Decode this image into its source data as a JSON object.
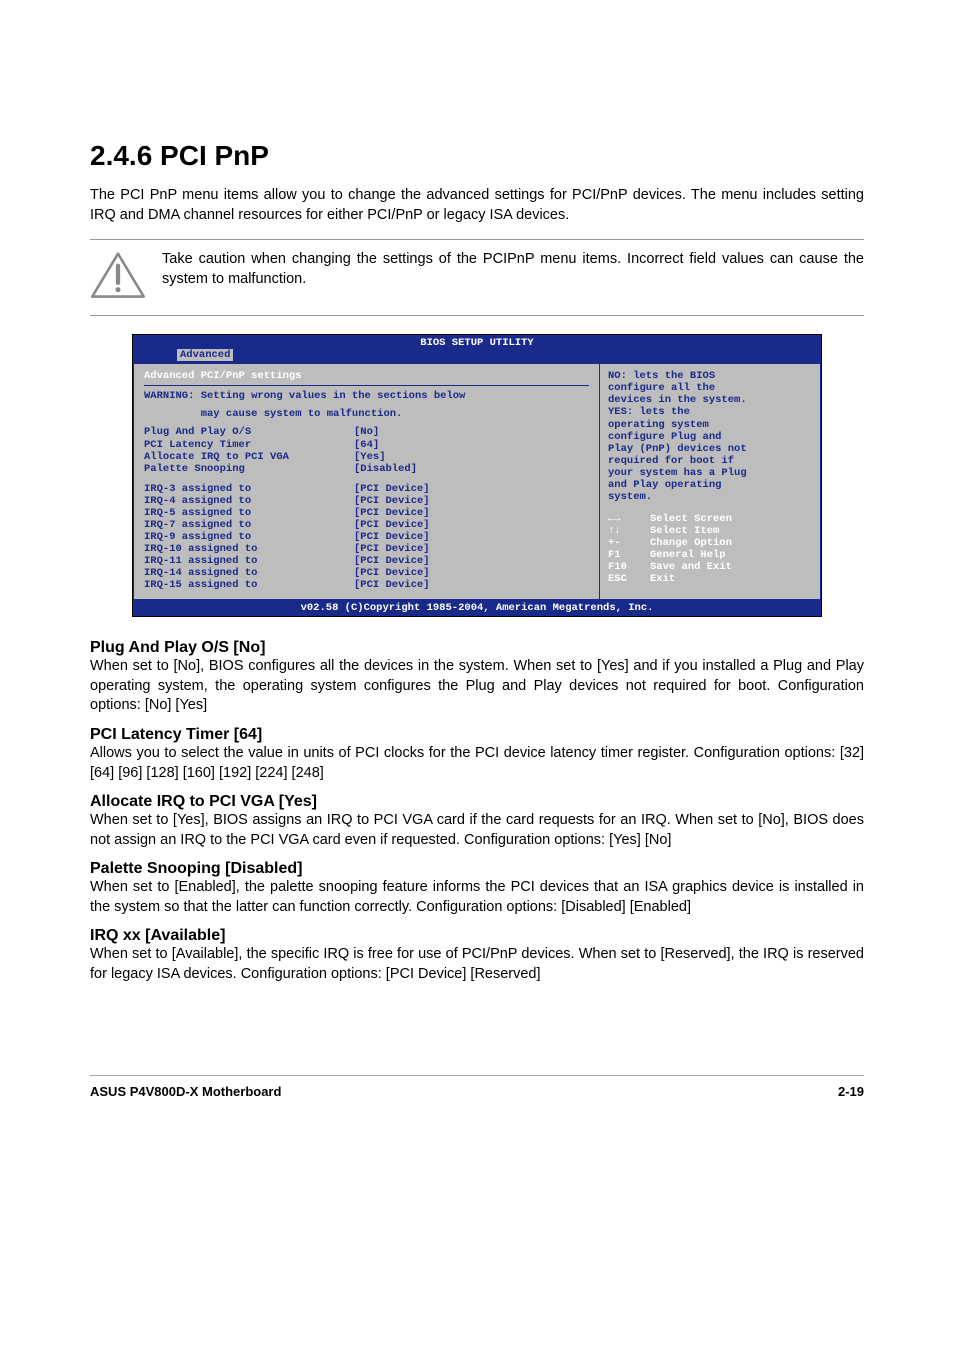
{
  "heading": "2.4.6   PCI PnP",
  "intro": "The PCI PnP menu items allow you to change the advanced settings for PCI/PnP devices. The menu includes setting IRQ and DMA channel resources for either PCI/PnP or legacy ISA devices.",
  "caution": "Take caution when changing the settings of the PCIPnP menu items. Incorrect field values can cause the system to malfunction.",
  "bios": {
    "title": "BIOS SETUP UTILITY",
    "tab_active": "Advanced",
    "subtitle": "Advanced PCI/PnP settings",
    "warning_l1": "WARNING: Setting wrong values in the sections below",
    "warning_l2": "         may cause system to malfunction.",
    "settings": [
      {
        "label": "Plug And Play O/S",
        "value": "[No]"
      },
      {
        "label": "PCI Latency Timer",
        "value": "[64]"
      },
      {
        "label": "Allocate IRQ to PCI VGA",
        "value": "[Yes]"
      },
      {
        "label": "Palette Snooping",
        "value": "[Disabled]"
      }
    ],
    "irqs": [
      {
        "label": "IRQ-3 assigned to",
        "value": "[PCI Device]"
      },
      {
        "label": "IRQ-4 assigned to",
        "value": "[PCI Device]"
      },
      {
        "label": "IRQ-5 assigned to",
        "value": "[PCI Device]"
      },
      {
        "label": "IRQ-7 assigned to",
        "value": "[PCI Device]"
      },
      {
        "label": "IRQ-9 assigned to",
        "value": "[PCI Device]"
      },
      {
        "label": "IRQ-10 assigned to",
        "value": "[PCI Device]"
      },
      {
        "label": "IRQ-11 assigned to",
        "value": "[PCI Device]"
      },
      {
        "label": "IRQ-14 assigned to",
        "value": "[PCI Device]"
      },
      {
        "label": "IRQ-15 assigned to",
        "value": "[PCI Device]"
      }
    ],
    "help": [
      "NO: lets the BIOS",
      "configure all the",
      "devices in the system.",
      "YES: lets the",
      "operating system",
      "configure Plug and",
      "Play (PnP) devices not",
      "required for boot if",
      "your system has a Plug",
      "and Play operating",
      "system."
    ],
    "nav": [
      {
        "key": "←→",
        "label": "Select Screen"
      },
      {
        "key": "↑↓",
        "label": "Select Item"
      },
      {
        "key": "+-",
        "label": "Change Option"
      },
      {
        "key": "F1",
        "label": "General Help"
      },
      {
        "key": "F10",
        "label": "Save and Exit"
      },
      {
        "key": "ESC",
        "label": "Exit"
      }
    ],
    "footer": "v02.58 (C)Copyright 1985-2004, American Megatrends, Inc."
  },
  "options": [
    {
      "title": "Plug And Play O/S [No]",
      "body": "When set to [No], BIOS configures all the devices in the system. When set to [Yes] and if you installed a Plug and Play operating system, the operating system configures the Plug and Play devices not required for boot. Configuration options: [No] [Yes]"
    },
    {
      "title": "PCI Latency Timer [64]",
      "body": "Allows you to select the value in units of PCI clocks for the PCI device latency timer register. Configuration options: [32] [64] [96] [128] [160] [192] [224] [248]"
    },
    {
      "title": "Allocate IRQ to PCI VGA [Yes]",
      "body": "When set to [Yes], BIOS assigns an IRQ to PCI VGA card if the card requests for an IRQ. When set to [No], BIOS does not assign an IRQ to the PCI VGA card even if requested. Configuration options: [Yes] [No]"
    },
    {
      "title": "Palette Snooping [Disabled]",
      "body": "When set to [Enabled], the palette snooping feature informs the PCI devices that an ISA graphics device is installed in the system so that the latter can function correctly. Configuration options: [Disabled] [Enabled]"
    },
    {
      "title": "IRQ xx [Available]",
      "body": "When set to [Available], the specific IRQ is free for use of PCI/PnP devices. When set to [Reserved], the IRQ is reserved for legacy ISA devices. Configuration options: [PCI Device] [Reserved]"
    }
  ],
  "footer_left": "ASUS P4V800D-X Motherboard",
  "footer_right": "2-19"
}
